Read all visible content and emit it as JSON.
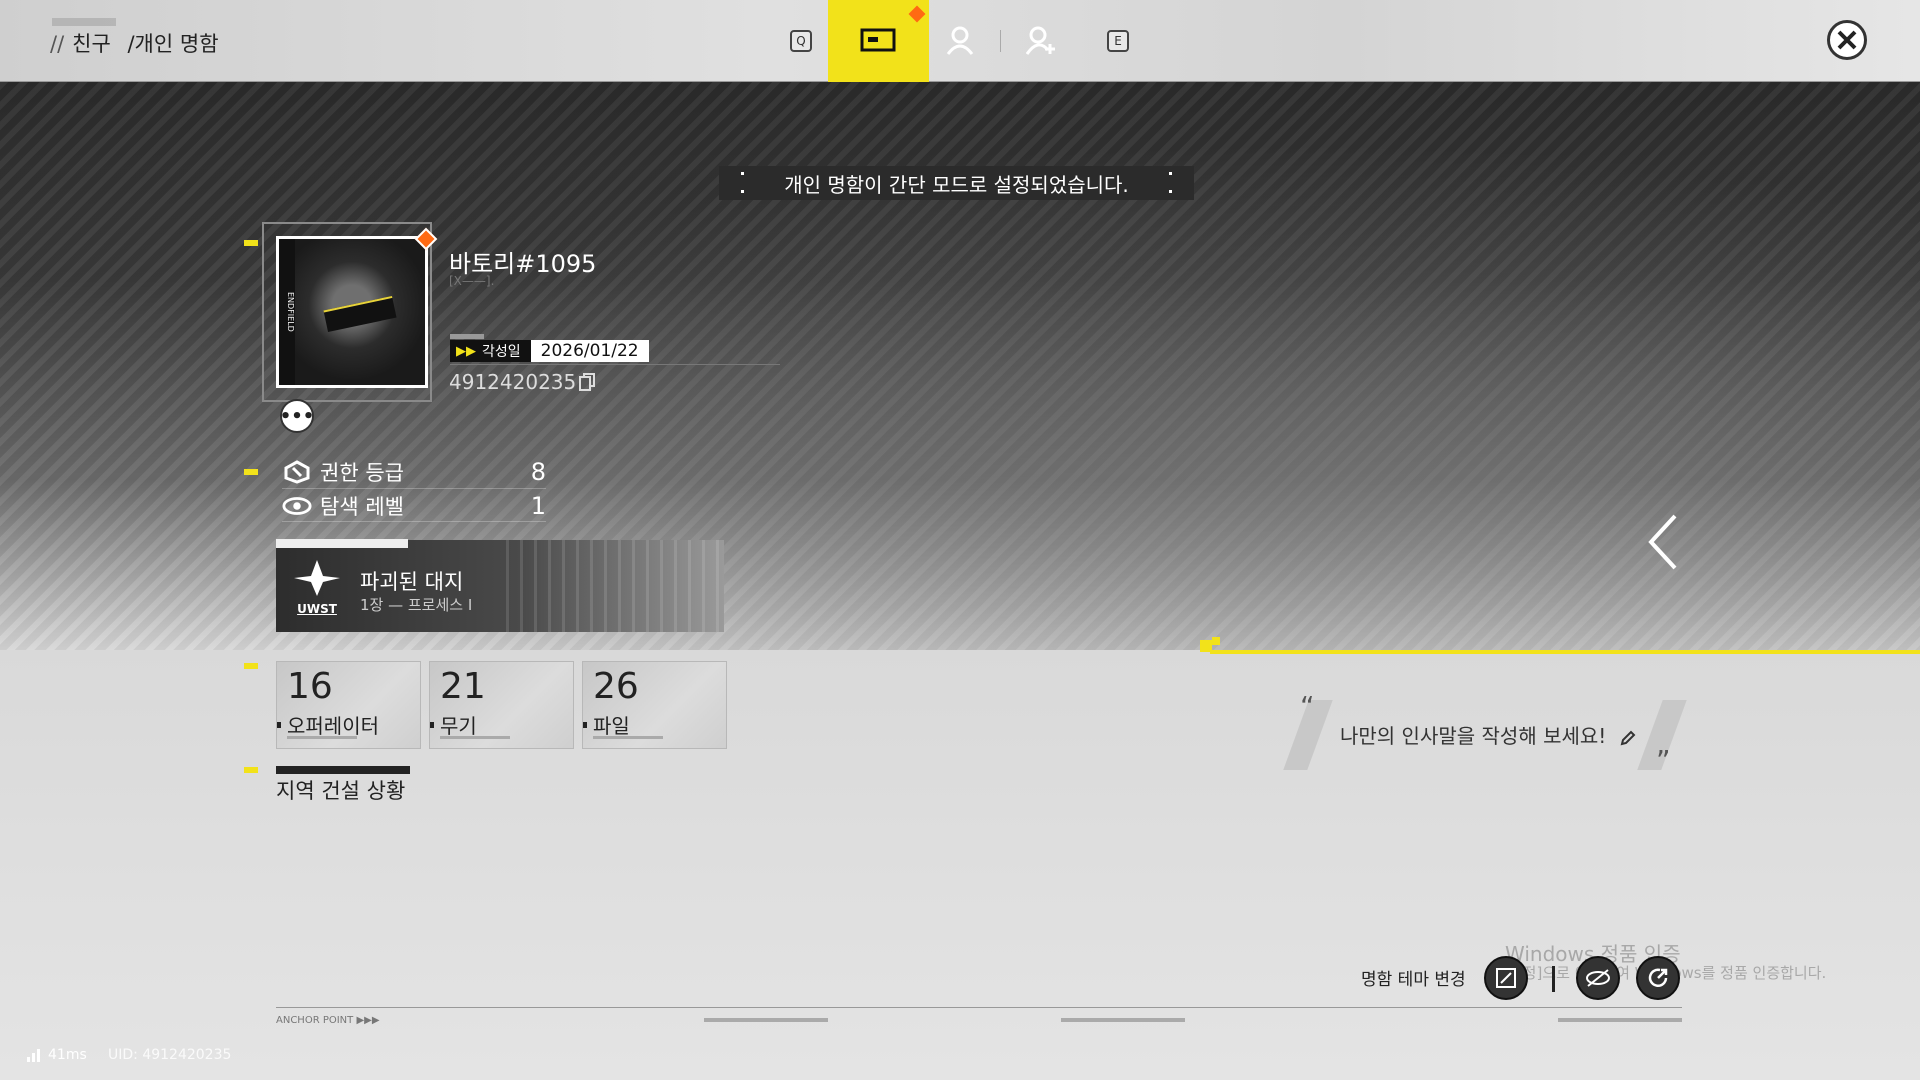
{
  "header": {
    "breadcrumb_prefix": "//",
    "breadcrumb_1": "친구",
    "breadcrumb_2": "/개인 명함",
    "tab_key_left": "Q",
    "tab_key_right": "E",
    "tabs": [
      "card-icon",
      "profile-icon",
      "add-friend-icon"
    ],
    "active_tab": "card-icon"
  },
  "notice": "개인 명함이 간단 모드로 설정되었습니다.",
  "profile": {
    "name": "바토리#1095",
    "subname": "[X——].",
    "portrait_side_text": "ENDFIELD",
    "awakening_label": "각성일",
    "awakening_date": "2026/01/22",
    "uid": "4912420235"
  },
  "stats": [
    {
      "label": "권한 등급",
      "value": "8",
      "icon": "authority-icon"
    },
    {
      "label": "탐색 레벨",
      "value": "1",
      "icon": "exploration-icon"
    }
  ],
  "mission": {
    "emblem_text": "UWST",
    "title": "파괴된 대지",
    "subtitle": "1장 — 프로세스 I"
  },
  "cards": [
    {
      "num": "16",
      "label": "오퍼레이터"
    },
    {
      "num": "21",
      "label": "무기"
    },
    {
      "num": "26",
      "label": "파일"
    }
  ],
  "region": "지역 건설 상황",
  "greeting": "나만의 인사말을 작성해 보세요!",
  "theme_change": "명함 테마 변경",
  "footer": {
    "anchor": "ANCHOR POINT",
    "ping": "41ms",
    "uid_label": "UID: 4912420235"
  },
  "watermark": {
    "title": "Windows 정품 인증",
    "text": "[설정]으로 이동하여 Windows를 정품 인증합니다."
  },
  "colors": {
    "accent": "#f2e21a",
    "orange": "#ff6a13"
  }
}
